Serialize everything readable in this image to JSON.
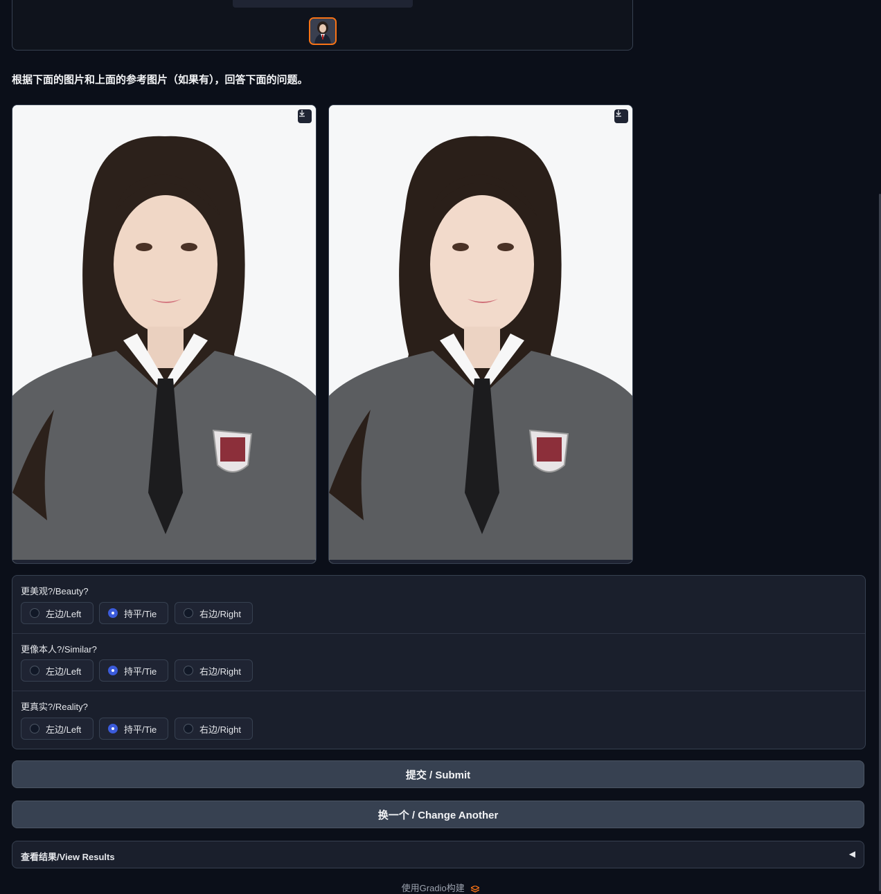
{
  "reference": {
    "thumbnail_alt": "reference portrait thumbnail"
  },
  "instruction": "根据下面的图片和上面的参考图片（如果有），回答下面的问题。",
  "images": [
    {
      "name": "left-image",
      "download_icon": "download-icon"
    },
    {
      "name": "right-image",
      "download_icon": "download-icon"
    }
  ],
  "questions": [
    {
      "label": "更美观?/Beauty?",
      "options": [
        "左边/Left",
        "持平/Tie",
        "右边/Right"
      ],
      "selected": "持平/Tie"
    },
    {
      "label": "更像本人?/Similar?",
      "options": [
        "左边/Left",
        "持平/Tie",
        "右边/Right"
      ],
      "selected": "持平/Tie"
    },
    {
      "label": "更真实?/Reality?",
      "options": [
        "左边/Left",
        "持平/Tie",
        "右边/Right"
      ],
      "selected": "持平/Tie"
    }
  ],
  "buttons": {
    "submit": "提交 / Submit",
    "change": "换一个 / Change Another"
  },
  "accordion": {
    "label": "查看结果/View Results",
    "arrow": "◀"
  },
  "footer": {
    "text": "使用Gradio构建"
  },
  "colors": {
    "accent": "#f97316",
    "radio_checked": "#3b5bdb",
    "background": "#0b0f19"
  }
}
